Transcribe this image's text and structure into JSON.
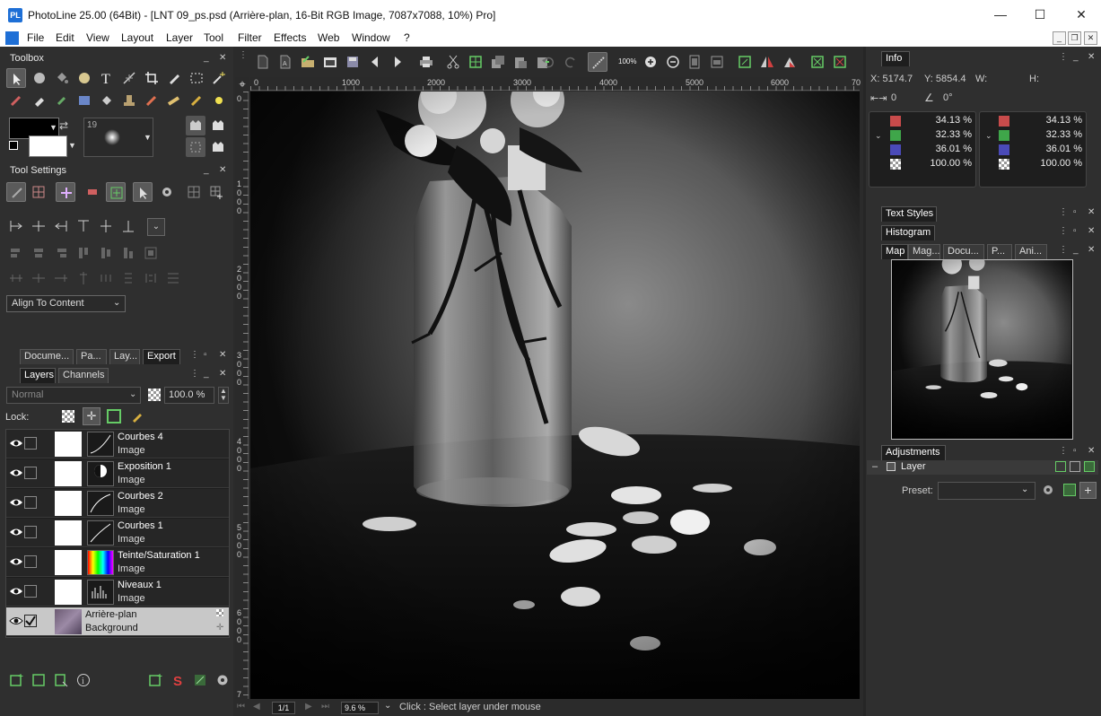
{
  "window": {
    "title": "PhotoLine 25.00 (64Bit) - [LNT 09_ps.psd (Arrière-plan, 16-Bit RGB Image, 7087x7088, 10%) Pro]",
    "logo": "PL"
  },
  "menu": [
    "File",
    "Edit",
    "View",
    "Layout",
    "Layer",
    "Tool",
    "Filter",
    "Effects",
    "Web",
    "Window",
    "?"
  ],
  "toolbar": {
    "zoom_label": "100%"
  },
  "toolbox": {
    "title": "Toolbox",
    "brush_size": "19"
  },
  "tool_settings": {
    "title": "Tool Settings",
    "align_select": "Align To Content"
  },
  "doc_tabs": [
    "Docume...",
    "Pa...",
    "Lay...",
    "Export"
  ],
  "layer_tabs": [
    "Layers",
    "Channels"
  ],
  "layers_panel": {
    "blend_mode": "Normal",
    "opacity": "100.0 %",
    "lock_label": "Lock:",
    "layers": [
      {
        "name": "Courbes 4",
        "type": "Image"
      },
      {
        "name": "Exposition 1",
        "type": "Image"
      },
      {
        "name": "Courbes 2",
        "type": "Image"
      },
      {
        "name": "Courbes 1",
        "type": "Image"
      },
      {
        "name": "Teinte/Saturation 1",
        "type": "Image"
      },
      {
        "name": "Niveaux 1",
        "type": "Image"
      },
      {
        "name": "Arrière-plan",
        "type": "Background"
      }
    ]
  },
  "rulers": {
    "h_labels": [
      "0",
      "1000",
      "2000",
      "3000",
      "4000",
      "5000",
      "6000",
      "70"
    ],
    "v_labels": [
      "0",
      "1",
      "0",
      "0",
      "0",
      "2",
      "0",
      "0",
      "0",
      "3",
      "0",
      "0",
      "0",
      "4",
      "0",
      "0",
      "0",
      "5",
      "0",
      "0",
      "0",
      "6",
      "0",
      "0",
      "0",
      "7"
    ]
  },
  "status": {
    "page": "1/1",
    "zoom": "9.6 %",
    "hint": "Click : Select layer under mouse"
  },
  "info": {
    "title": "Info",
    "x": "X: 5174.7",
    "y": "Y: 5854.4",
    "w": "W:",
    "h": "H:",
    "dist": "0",
    "angle": "0°",
    "left_values": [
      "34.13 %",
      "32.33 %",
      "36.01 %",
      "100.00 %"
    ],
    "right_values": [
      "34.13 %",
      "32.33 %",
      "36.01 %",
      "100.00 %"
    ],
    "channel_colors": [
      "#c84b4b",
      "#3fa64a",
      "#4a4ab8"
    ]
  },
  "right_panels": {
    "text_styles": "Text Styles",
    "histogram": "Histogram",
    "map_tabs": [
      "Map",
      "Mag...",
      "Docu...",
      "P...",
      "Ani..."
    ],
    "adjustments": "Adjustments",
    "adj_layer": "Layer",
    "preset_label": "Preset:"
  }
}
